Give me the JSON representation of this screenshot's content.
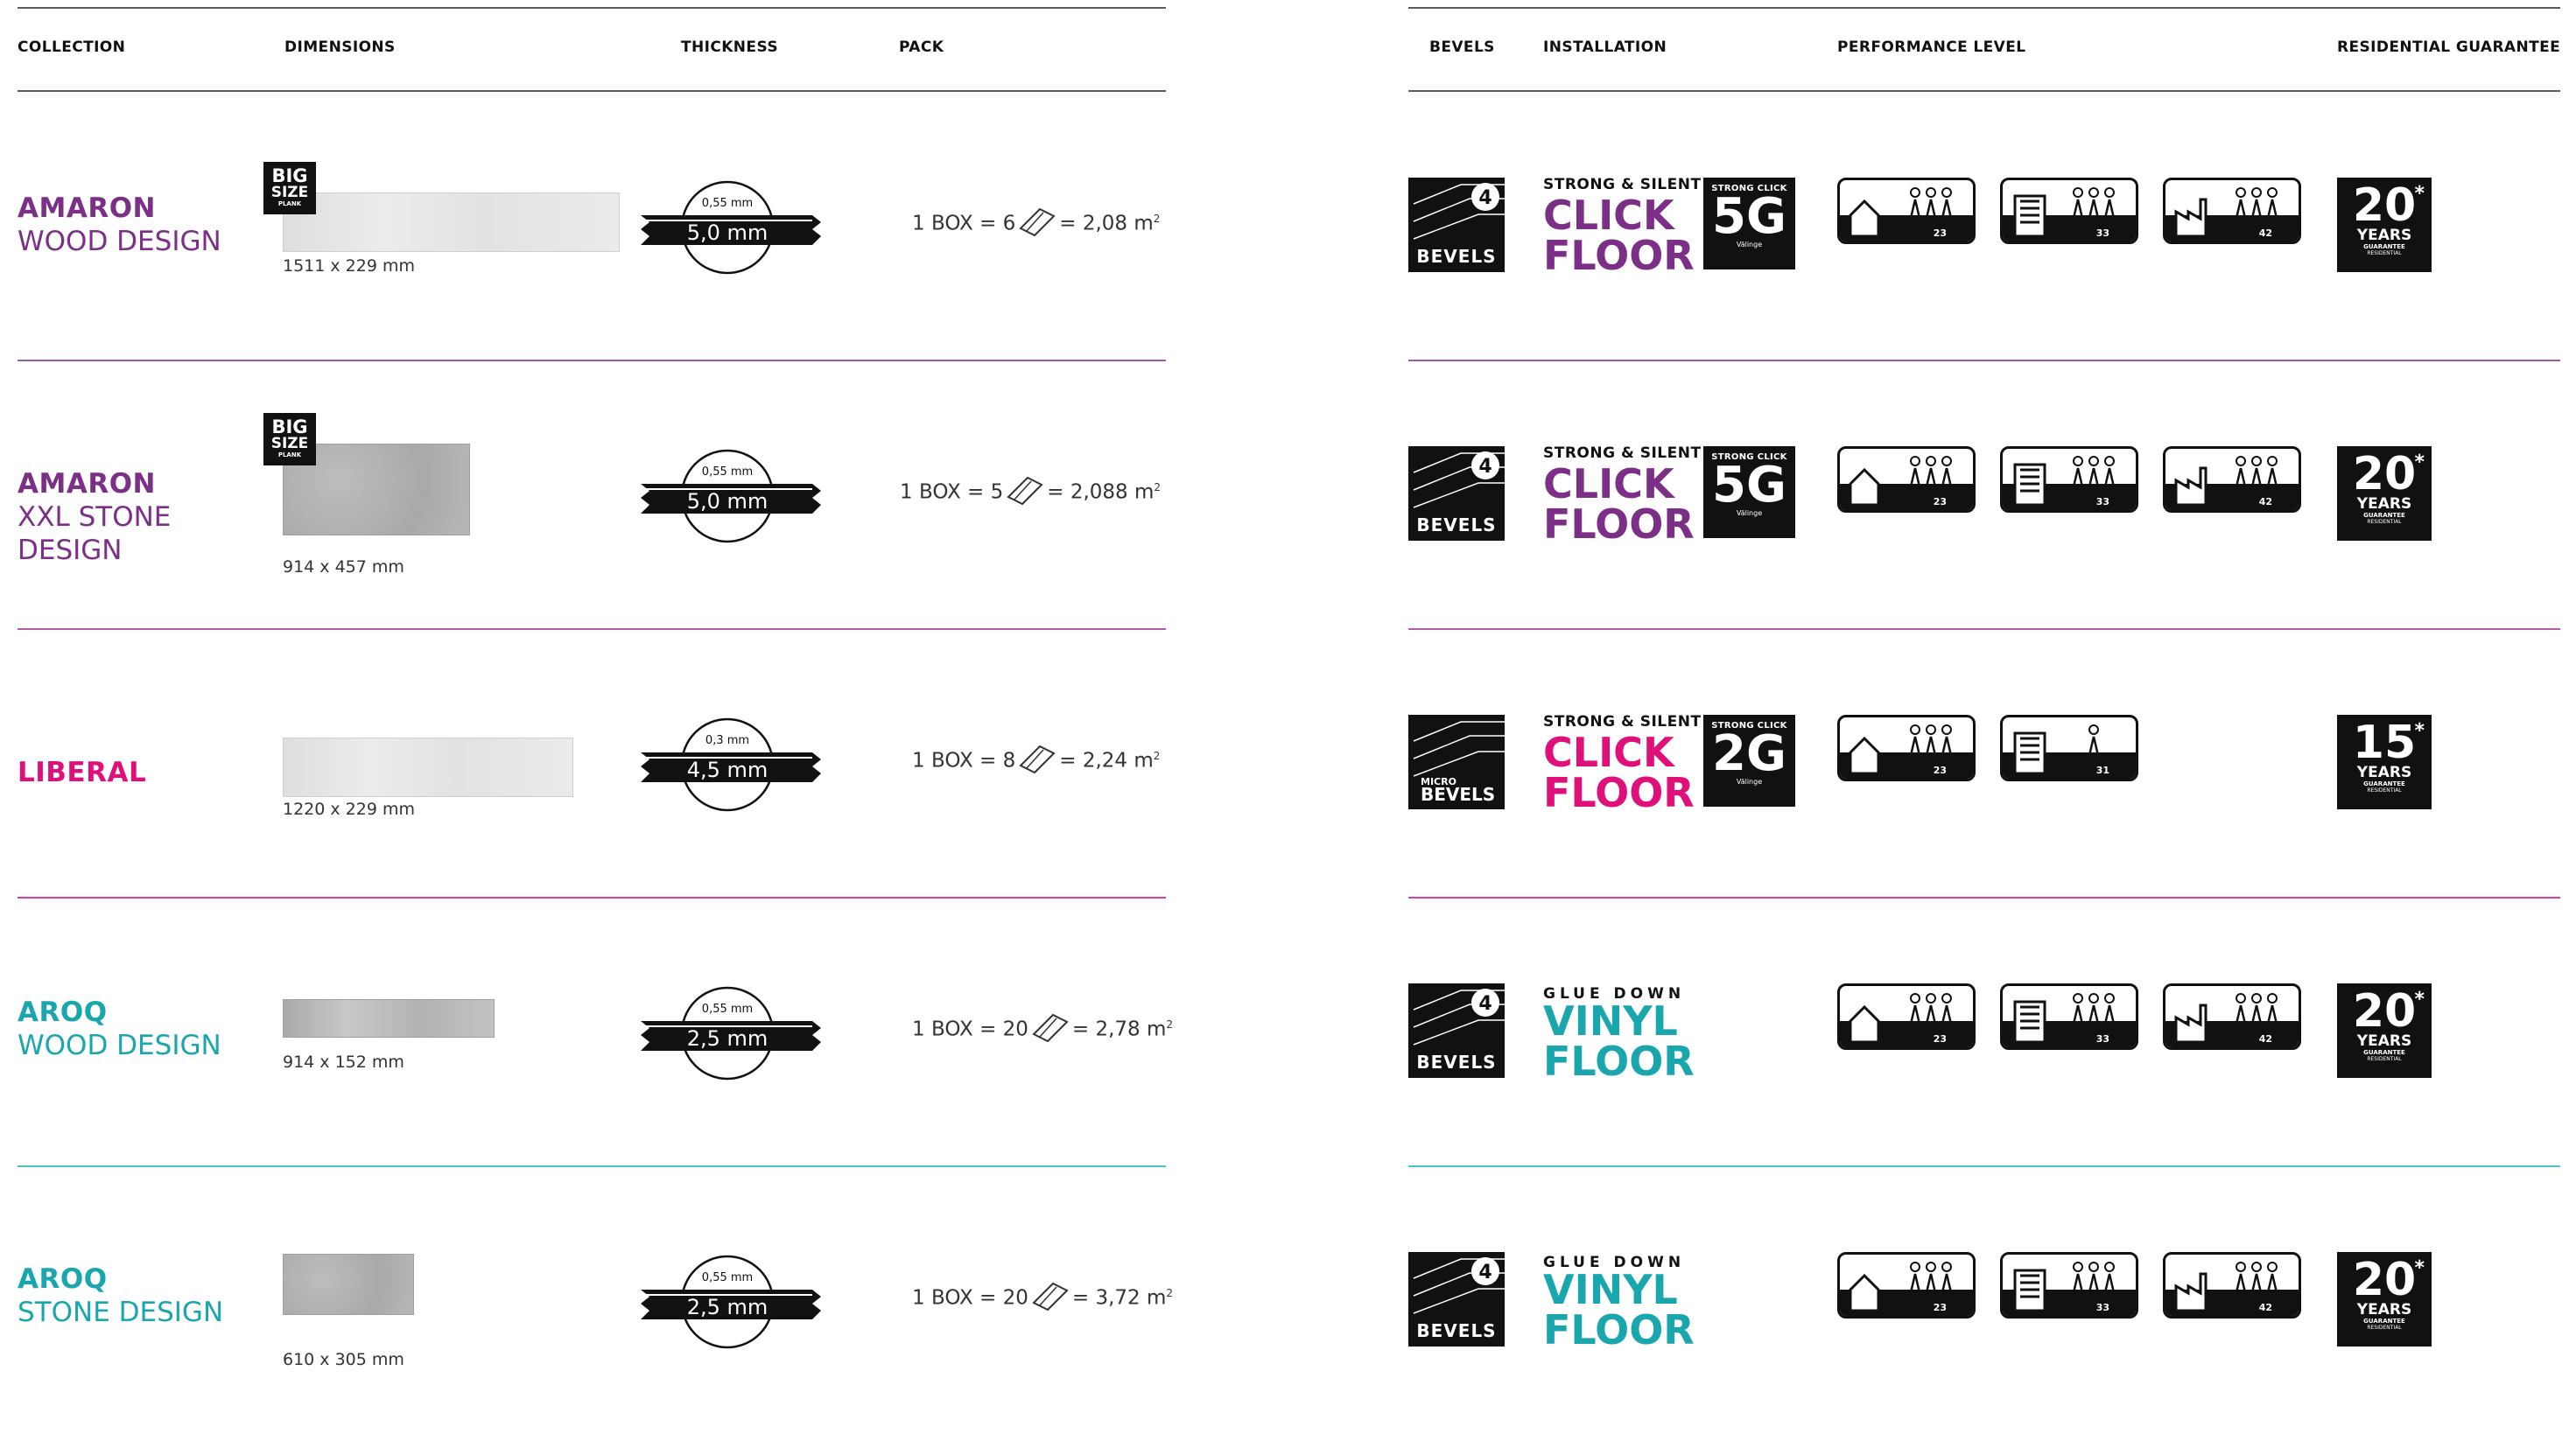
{
  "headers": {
    "collection": "COLLECTION",
    "dimensions": "DIMENSIONS",
    "thickness": "THICKNESS",
    "pack": "PACK",
    "bevels": "BEVELS",
    "installation": "INSTALLATION",
    "performance": "PERFORMANCE LEVEL",
    "guarantee": "RESIDENTIAL GUARANTEE"
  },
  "colors": {
    "purple": "#7b2f87",
    "magenta": "#e0107a",
    "teal": "#1aa6ad"
  },
  "rows": [
    {
      "name_line1": "AMARON",
      "name_line2": "WOOD DESIGN",
      "name_color": "#7b2f87",
      "line_color": "#9b5aa5",
      "badge": {
        "big": "BIG",
        "size": "SIZE",
        "plank": "PLANK"
      },
      "dims": "1511 x 229 mm",
      "wear": "0,55 mm",
      "total": "5,0 mm",
      "pack": "1 BOX = 6",
      "area": "= 2,08 m",
      "sup": "2",
      "bevel_label": "BEVELS",
      "bevel_number": "4",
      "inst_top": "STRONG & SILENT",
      "inst_l1": "CLICK",
      "inst_l2": "FLOOR",
      "inst_color": "#7b2f87",
      "sc": {
        "label": "STRONG CLICK",
        "code": "5G",
        "sub": "Välinge"
      },
      "perf": [
        "23",
        "33",
        "42"
      ],
      "guarantee": {
        "num": "20",
        "star": "*",
        "years": "YEARS",
        "g": "GUARANTEE",
        "r": "RESIDENTIAL"
      }
    },
    {
      "name_line1": "AMARON",
      "name_line2": "XXL STONE DESIGN",
      "name_color": "#7b2f87",
      "line_color": "#b45aa8",
      "badge": {
        "big": "BIG",
        "size": "SIZE",
        "plank": "PLANK"
      },
      "dims": "914 x 457 mm",
      "wear": "0,55 mm",
      "total": "5,0 mm",
      "pack": "1 BOX = 5",
      "area": "= 2,088 m",
      "sup": "2",
      "bevel_label": "BEVELS",
      "bevel_number": "4",
      "inst_top": "STRONG & SILENT",
      "inst_l1": "CLICK",
      "inst_l2": "FLOOR",
      "inst_color": "#7b2f87",
      "sc": {
        "label": "STRONG CLICK",
        "code": "5G",
        "sub": "Välinge"
      },
      "perf": [
        "23",
        "33",
        "42"
      ],
      "guarantee": {
        "num": "20",
        "star": "*",
        "years": "YEARS",
        "g": "GUARANTEE",
        "r": "RESIDENTIAL"
      }
    },
    {
      "name_line1": "LIBERAL",
      "name_line2": "",
      "name_color": "#e0107a",
      "line_color": "#e0409a",
      "dims": "1220 x 229 mm",
      "wear": "0,3 mm",
      "total": "4,5 mm",
      "pack": "1 BOX = 8",
      "area": "= 2,24 m",
      "sup": "2",
      "bevel_label": "BEVELS",
      "bevel_micro": "MICRO",
      "inst_top": "STRONG & SILENT",
      "inst_l1": "CLICK",
      "inst_l2": "FLOOR",
      "inst_color": "#e0107a",
      "sc": {
        "label": "STRONG CLICK",
        "code": "2G",
        "sub": "Välinge"
      },
      "perf": [
        "23",
        "31"
      ],
      "guarantee": {
        "num": "15",
        "star": "*",
        "years": "YEARS",
        "g": "GUARANTEE",
        "r": "RESIDENTIAL"
      }
    },
    {
      "name_line1": "AROQ",
      "name_line2": "WOOD DESIGN",
      "name_color": "#1aa6ad",
      "line_color": "#4ec0c6",
      "dims": "914 x 152 mm",
      "wear": "0,55 mm",
      "total": "2,5 mm",
      "pack": "1 BOX = 20",
      "area": "= 2,78 m",
      "sup": "2",
      "bevel_label": "BEVELS",
      "bevel_number": "4",
      "inst_top": "GLUE DOWN",
      "inst_l1": "VINYL",
      "inst_l2": "FLOOR",
      "inst_color": "#1aa6ad",
      "perf": [
        "23",
        "33",
        "42"
      ],
      "guarantee": {
        "num": "20",
        "star": "*",
        "years": "YEARS",
        "g": "GUARANTEE",
        "r": "RESIDENTIAL"
      }
    },
    {
      "name_line1": "AROQ",
      "name_line2": "STONE DESIGN",
      "name_color": "#1aa6ad",
      "line_color": null,
      "dims": "610 x 305 mm",
      "wear": "0,55 mm",
      "total": "2,5 mm",
      "pack": "1 BOX = 20",
      "area": "= 3,72 m",
      "sup": "2",
      "bevel_label": "BEVELS",
      "bevel_number": "4",
      "inst_top": "GLUE DOWN",
      "inst_l1": "VINYL",
      "inst_l2": "FLOOR",
      "inst_color": "#1aa6ad",
      "perf": [
        "23",
        "33",
        "42"
      ],
      "guarantee": {
        "num": "20",
        "star": "*",
        "years": "YEARS",
        "g": "GUARANTEE",
        "r": "RESIDENTIAL"
      }
    }
  ]
}
